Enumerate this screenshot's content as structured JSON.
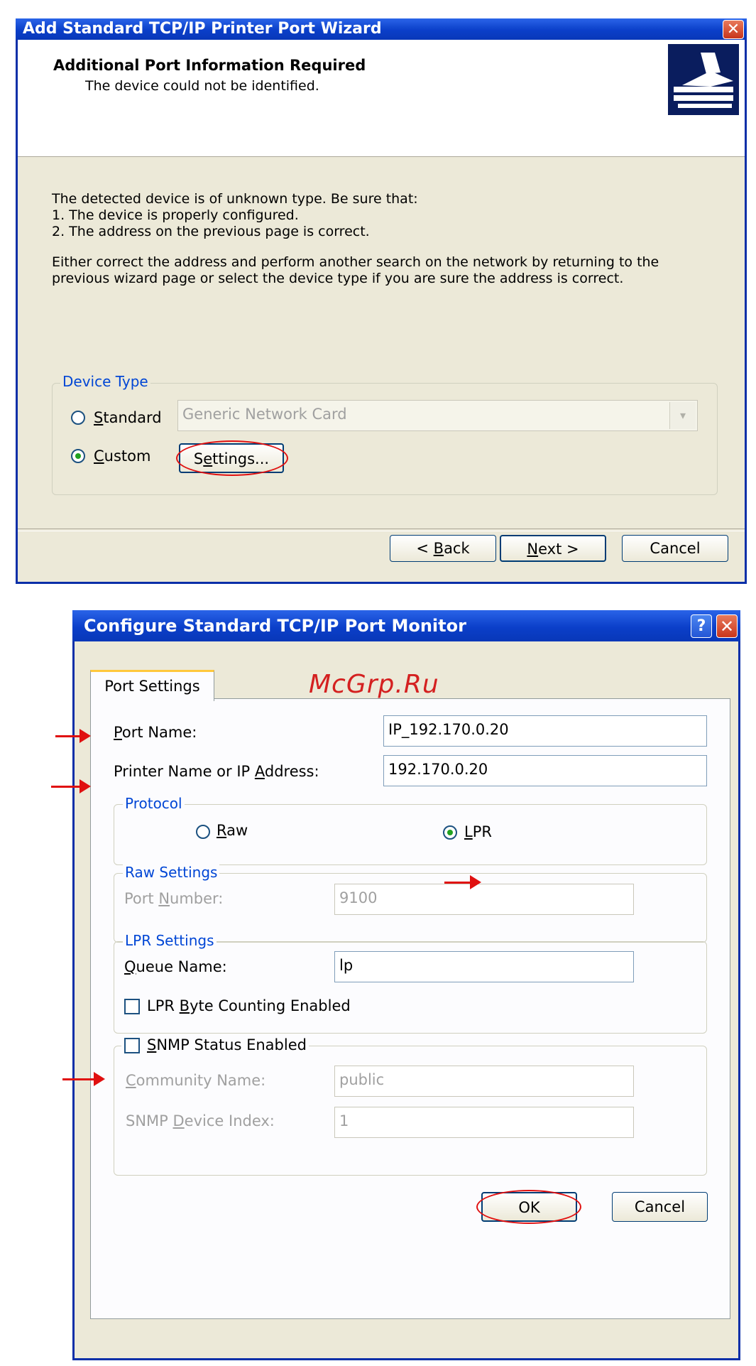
{
  "wizard": {
    "title": "Add Standard TCP/IP Printer Port Wizard",
    "header_title": "Additional Port Information Required",
    "header_subtitle": "The device could not be identified.",
    "line1": "The detected device is of unknown type.  Be sure that:",
    "line2": "1. The device is properly configured.",
    "line3": "2.  The address on the previous page is correct.",
    "line4": "Either correct the address and perform another search on the network by returning to the",
    "line5": "previous wizard page or select the device type if you are sure the address is correct.",
    "device_type_legend": "Device Type",
    "standard_label": "Standard",
    "standard_underline": "S",
    "standard_rest": "tandard",
    "standard_value": "Generic Network Card",
    "custom_underline": "C",
    "custom_rest": "ustom",
    "settings_button": "Settings...",
    "settings_pre": "S",
    "settings_u": "e",
    "settings_post": "ttings...",
    "back_pre": "< ",
    "back_u": "B",
    "back_post": "ack",
    "next_u": "N",
    "next_post": "ext >",
    "cancel": "Cancel",
    "selected_device_type": "Custom"
  },
  "monitor": {
    "title": "Configure Standard TCP/IP Port Monitor",
    "watermark": "McGrp.Ru",
    "tab": "Port Settings",
    "port_name_u": "P",
    "port_name_rest": "ort Name:",
    "port_name_value": "IP_192.170.0.20",
    "printer_label_pre": "Printer Name or IP ",
    "printer_label_u": "A",
    "printer_label_post": "ddress:",
    "printer_value": "192.170.0.20",
    "protocol_legend": "Protocol",
    "raw_u": "R",
    "raw_rest": "aw",
    "lpr_u": "L",
    "lpr_rest": "PR",
    "selected_protocol": "LPR",
    "raw_settings_legend": "Raw Settings",
    "port_number_pre": "Port ",
    "port_number_u": "N",
    "port_number_post": "umber:",
    "port_number_value": "9100",
    "lpr_settings_legend": "LPR Settings",
    "queue_u": "Q",
    "queue_rest": "ueue Name:",
    "queue_value": "lp",
    "byte_pre": "LPR ",
    "byte_u": "B",
    "byte_post": "yte Counting Enabled",
    "snmp_u": "S",
    "snmp_rest": "NMP Status Enabled",
    "community_u": "C",
    "community_rest": "ommunity Name:",
    "community_value": "public",
    "device_index_pre": "SNMP ",
    "device_index_u": "D",
    "device_index_post": "evice Index:",
    "device_index_value": "1",
    "ok": "OK",
    "cancel": "Cancel"
  },
  "colors": {
    "title_bar": "#0b3fc9",
    "dialog_bg": "#ece9d8",
    "annotation": "#e01010",
    "group_label": "#0046d5"
  }
}
